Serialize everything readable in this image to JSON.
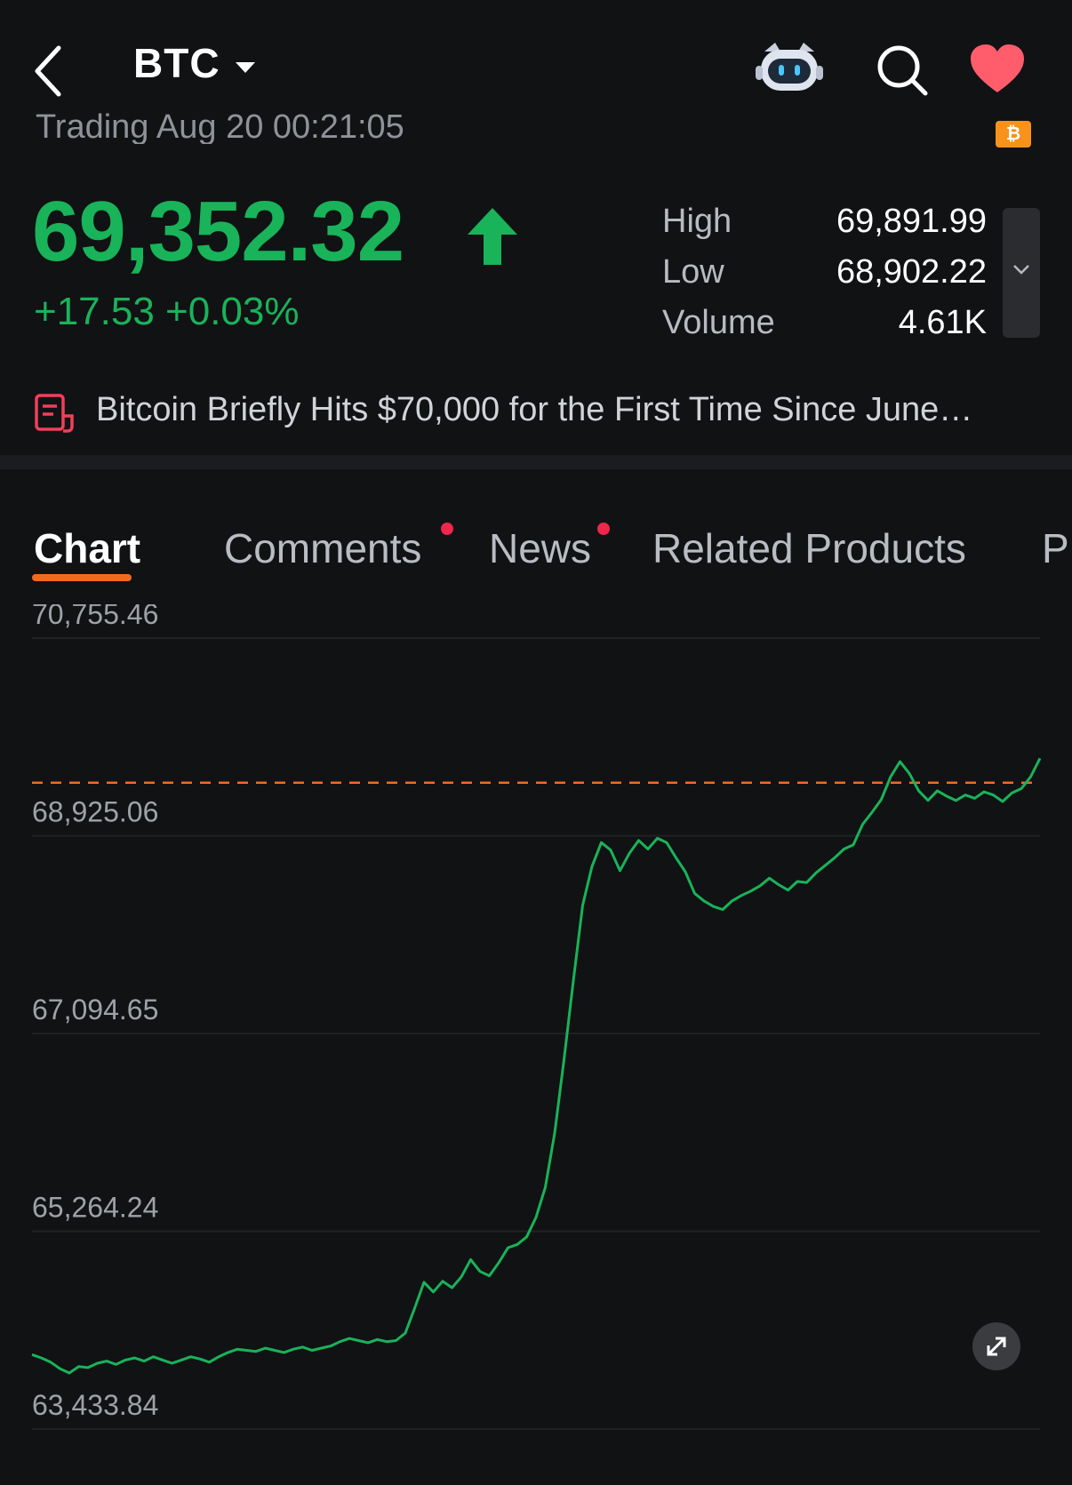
{
  "header": {
    "symbol": "BTC",
    "icons": [
      "back-icon",
      "dropdown-caret-icon",
      "robot-assistant-icon",
      "search-icon",
      "heart-icon"
    ]
  },
  "quote": {
    "trading_time": "Trading Aug 20 00:21:05",
    "price": "69,352.32",
    "change": "+17.53 +0.03%",
    "direction": "up",
    "color_up": "#19b35a",
    "stats": [
      {
        "label": "High",
        "value": "69,891.99"
      },
      {
        "label": "Low",
        "value": "68,902.22"
      },
      {
        "label": "Volume",
        "value": "4.61K"
      }
    ]
  },
  "news_banner": {
    "headline": "Bitcoin Briefly Hits $70,000 for the First Time Since June…"
  },
  "tabs": [
    {
      "label": "Chart",
      "active": true
    },
    {
      "label": "Comments",
      "dot": true
    },
    {
      "label": "News",
      "dot": true
    },
    {
      "label": "Related Products"
    },
    {
      "label": "P"
    }
  ],
  "accent_color": "#f26a21",
  "chart_data": {
    "type": "line",
    "y_ticks": [
      "70,755.46",
      "68,925.06",
      "67,094.65",
      "65,264.24",
      "63,433.84"
    ],
    "ylim": [
      63433.84,
      70755.46
    ],
    "reference_line": 69334.79,
    "series": [
      {
        "color": "#19b35a",
        "values": [
          64040,
          64010,
          63970,
          63910,
          63870,
          63930,
          63920,
          63960,
          63980,
          63950,
          63990,
          64010,
          63980,
          64020,
          63990,
          63960,
          63990,
          64020,
          64000,
          63970,
          64020,
          64060,
          64090,
          64080,
          64070,
          64100,
          64080,
          64060,
          64090,
          64110,
          64080,
          64100,
          64120,
          64160,
          64190,
          64170,
          64150,
          64180,
          64160,
          64170,
          64240,
          64470,
          64710,
          64620,
          64720,
          64660,
          64760,
          64920,
          64810,
          64770,
          64890,
          65030,
          65060,
          65130,
          65310,
          65590,
          66090,
          66770,
          67500,
          68200,
          68560,
          68780,
          68710,
          68520,
          68680,
          68800,
          68720,
          68820,
          68780,
          68640,
          68510,
          68310,
          68240,
          68190,
          68160,
          68240,
          68290,
          68330,
          68380,
          68450,
          68390,
          68340,
          68420,
          68410,
          68500,
          68570,
          68640,
          68720,
          68760,
          68950,
          69060,
          69180,
          69390,
          69530,
          69420,
          69260,
          69170,
          69260,
          69210,
          69170,
          69220,
          69190,
          69250,
          69220,
          69160,
          69240,
          69280,
          69390,
          69560
        ]
      }
    ],
    "grid": true,
    "fullscreen_icon": "expand-arrows-icon"
  }
}
